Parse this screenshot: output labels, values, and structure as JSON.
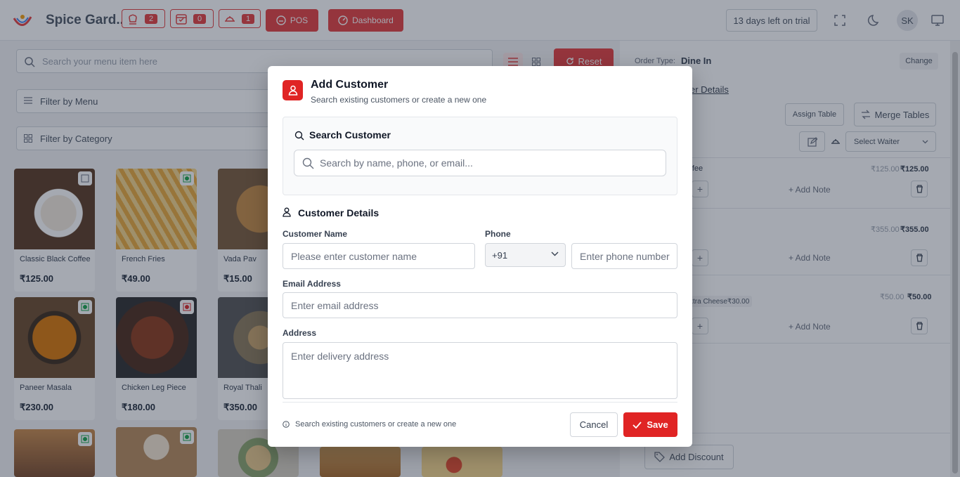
{
  "header": {
    "restaurant_name": "Spice Gard...",
    "badges": [
      {
        "icon": "chef-icon",
        "count": "2"
      },
      {
        "icon": "calendar-check-icon",
        "count": "0"
      },
      {
        "icon": "delivery-icon",
        "count": "1"
      }
    ],
    "pos_label": "POS",
    "dashboard_label": "Dashboard",
    "trial_text": "13 days left on trial",
    "avatar_initials": "SK"
  },
  "menu": {
    "search_placeholder": "Search your menu item here",
    "reset_label": "Reset",
    "filter_menu": "Filter by Menu",
    "filter_category": "Filter by Category",
    "items": [
      {
        "name": "Classic Black Coffee",
        "price": "₹125.00"
      },
      {
        "name": "French Fries",
        "price": "₹49.00"
      },
      {
        "name": "Vada Pav",
        "price": "₹15.00"
      },
      {
        "name": "Paneer Masala",
        "price": "₹230.00"
      },
      {
        "name": "Chicken Leg Piece",
        "price": "₹180.00"
      },
      {
        "name": "Royal Thali",
        "price": "₹350.00"
      }
    ]
  },
  "order": {
    "order_type_label": "Order Type:",
    "order_type_value": "Dine In",
    "change_label": "Change",
    "customer_details_link": "er Details",
    "assign_table": "Assign Table",
    "merge_tables": "Merge Tables",
    "select_waiter": "Select Waiter",
    "lines": [
      {
        "name": "ffee",
        "unit_price": "₹125.00",
        "total": "₹125.00",
        "add_note": "+ Add Note"
      },
      {
        "name": "",
        "unit_price": "₹355.00",
        "total": "₹355.00",
        "add_note": "+ Add Note"
      },
      {
        "name": "xtra Cheese",
        "modifier_price": "₹30.00",
        "unit_price": "₹50.00",
        "total": "₹50.00",
        "add_note": "+ Add Note"
      }
    ],
    "add_discount": "Add Discount"
  },
  "modal": {
    "title": "Add Customer",
    "subtitle": "Search existing customers or create a new one",
    "search_section_title": "Search Customer",
    "search_placeholder": "Search by name, phone, or email...",
    "details_title": "Customer Details",
    "name_label": "Customer Name",
    "name_placeholder": "Please enter customer name",
    "phone_label": "Phone",
    "country_code": "+91",
    "phone_placeholder": "Enter phone number",
    "email_label": "Email Address",
    "email_placeholder": "Enter email address",
    "address_label": "Address",
    "address_placeholder": "Enter delivery address",
    "footer_hint": "Search existing customers or create a new one",
    "cancel_label": "Cancel",
    "save_label": "Save"
  }
}
